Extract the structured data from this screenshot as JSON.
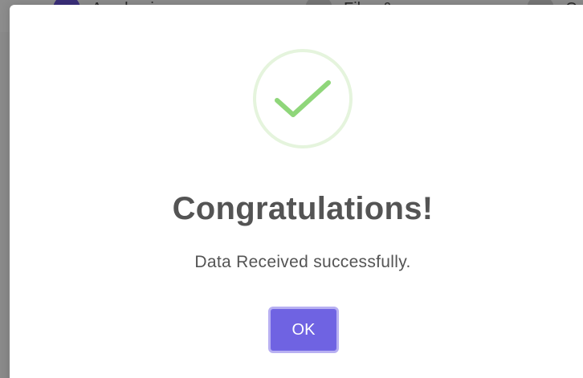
{
  "background": {
    "steps": [
      {
        "label": "Academic",
        "active": true
      },
      {
        "label": "Files &",
        "active": false
      },
      {
        "label": "C",
        "active": false
      }
    ]
  },
  "modal": {
    "icon": "checkmark-success-icon",
    "title": "Congratulations!",
    "message": "Data Received successfully.",
    "ok_label": "OK"
  },
  "colors": {
    "accent": "#7166e4",
    "success": "#8fd67a",
    "success_ring": "#e5f4dd",
    "text": "#545454"
  }
}
